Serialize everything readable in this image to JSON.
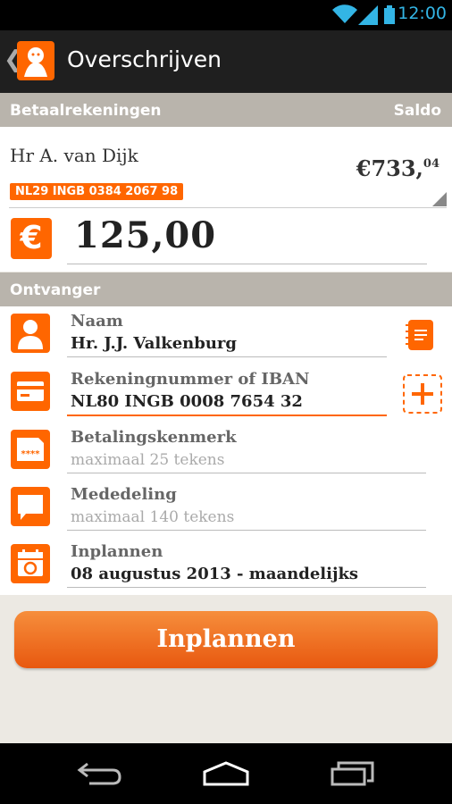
{
  "status_bar": {
    "time": "12:00"
  },
  "action_bar": {
    "back_glyph": "❮",
    "title": "Overschrijven"
  },
  "accounts_header": {
    "label": "Betaalrekeningen",
    "balance_label": "Saldo"
  },
  "account": {
    "holder": "Hr A. van Dijk",
    "iban": "NL29 INGB 0384 2067 98",
    "balance_main": "€733,",
    "balance_cents": "04"
  },
  "amount": {
    "currency_symbol": "€",
    "value": "125,00"
  },
  "receiver_header": {
    "label": "Ontvanger"
  },
  "fields": {
    "name": {
      "label": "Naam",
      "value": "Hr. J.J. Valkenburg"
    },
    "account_number": {
      "label": "Rekeningnummer of IBAN",
      "value": "NL80 INGB 0008 7654 32"
    },
    "reference": {
      "label": "Betalingskenmerk",
      "placeholder": "maximaal 25 tekens",
      "icon_text": "****"
    },
    "message": {
      "label": "Mededeling",
      "placeholder": "maximaal 140 tekens"
    },
    "schedule": {
      "label": "Inplannen",
      "value": "08 augustus 2013 - maandelijks"
    }
  },
  "submit": {
    "label": "Inplannen"
  },
  "colors": {
    "accent": "#ff6600",
    "header_bg": "#b9b4ac",
    "status_blue": "#33b5e5"
  },
  "icons": {
    "status": [
      "wifi-icon",
      "signal-icon",
      "battery-icon"
    ],
    "rows": [
      "person-icon",
      "card-icon",
      "document-icon",
      "speech-bubble-icon",
      "calendar-icon"
    ],
    "side": [
      "address-book-icon",
      "add-icon"
    ],
    "nav": [
      "nav-back-icon",
      "nav-home-icon",
      "nav-recent-icon"
    ]
  }
}
